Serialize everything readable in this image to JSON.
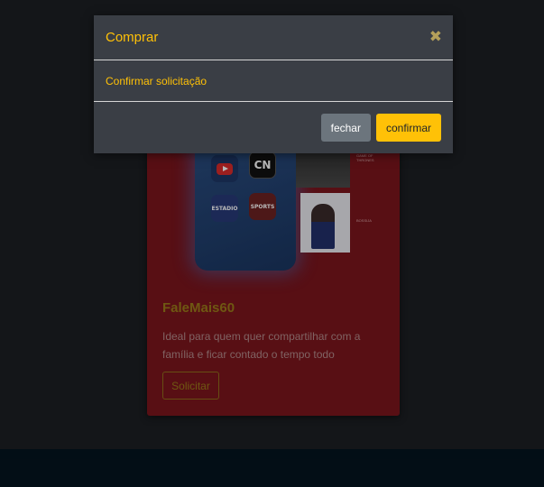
{
  "modal": {
    "title": "Comprar",
    "close_icon": "close-icon",
    "body_text": "Confirmar solicitação",
    "cancel_label": "fechar",
    "confirm_label": "confirmar"
  },
  "card": {
    "app_cn": "CN",
    "app_estadio": "ESTADIO",
    "app_sports": "SPORTS",
    "thumb_label_1": "GAME OF THRONES",
    "thumb_label_2": "BOSSIJA",
    "title": "FaleMais60",
    "description": "Ideal para quem quer compartilhar com a família e ficar contado o tempo todo",
    "button_label": "Solicitar"
  },
  "colors": {
    "accent": "#ffc107",
    "card_bg": "#7a151d",
    "modal_bg": "#3a3e45",
    "secondary_btn": "#6c757d"
  }
}
